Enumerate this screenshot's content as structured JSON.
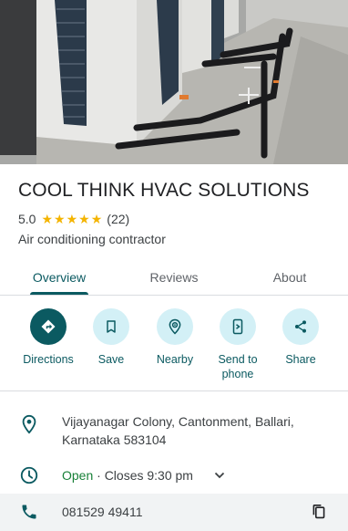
{
  "place": {
    "name": "COOL THINK HVAC SOLUTIONS",
    "rating": "5.0",
    "review_count": "(22)",
    "stars": 5,
    "category": "Air conditioning contractor"
  },
  "tabs": [
    {
      "label": "Overview",
      "active": true
    },
    {
      "label": "Reviews",
      "active": false
    },
    {
      "label": "About",
      "active": false
    }
  ],
  "actions": [
    {
      "label": "Directions",
      "icon": "directions-icon"
    },
    {
      "label": "Save",
      "icon": "bookmark-icon"
    },
    {
      "label": "Nearby",
      "icon": "nearby-icon"
    },
    {
      "label": "Send to phone",
      "icon": "send-to-phone-icon"
    },
    {
      "label": "Share",
      "icon": "share-icon"
    }
  ],
  "info": {
    "address": "Vijayanagar Colony, Cantonment, Ballari, Karnataka 583104",
    "hours_status": "Open",
    "hours_detail": " · Closes 9:30 pm",
    "phone": "081529 49411"
  },
  "colors": {
    "accent": "#0b5a61",
    "accent_light": "#d3f0f6",
    "star": "#f4b400",
    "open": "#188038"
  }
}
